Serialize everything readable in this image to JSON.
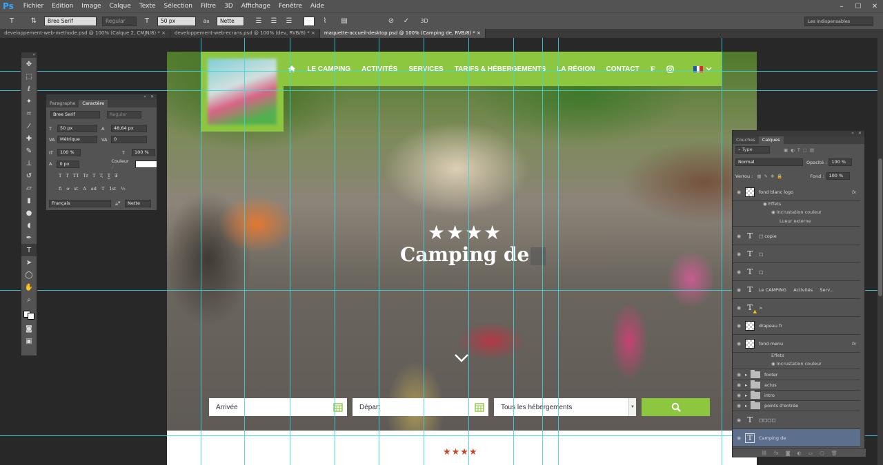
{
  "app": {
    "logo": "Ps",
    "menu": [
      "Fichier",
      "Edition",
      "Image",
      "Calque",
      "Texte",
      "Sélection",
      "Filtre",
      "3D",
      "Affichage",
      "Fenêtre",
      "Aide"
    ],
    "workspace": "Les indispensables"
  },
  "options": {
    "font_family": "Bree Serif",
    "font_style": "Regular",
    "font_size": "50 px",
    "aa": "Nette",
    "aa_label": "a",
    "aa_sup": "a"
  },
  "doc_tabs": [
    {
      "label": "developpement-web-methode.psd @ 100% (Calque 2, CMJN/8) *",
      "close": "×"
    },
    {
      "label": "developpement-web-ecrans.psd @ 100% (dev, RVB/8) *",
      "close": "×"
    },
    {
      "label": "maquette-accueil-desktop.psd @ 100% (Camping de, RVB/8) *",
      "close": "×"
    }
  ],
  "site": {
    "nav": [
      "LE CAMPING",
      "ACTIVITÉS",
      "SERVICES",
      "TARIFS & HÉBERGEMENTS",
      "LA RÉGION",
      "CONTACT"
    ],
    "stars": "★★★★",
    "title": "Camping de",
    "search": {
      "arrival": "Arrivée",
      "departure": "Départ",
      "lodging": "Tous les hébergements"
    },
    "small_stars": "★★★★"
  },
  "char_panel": {
    "tabs": [
      "Paragraphe",
      "Caractère"
    ],
    "font": "Bree Serif",
    "style": "Regular",
    "size": "50 px",
    "leading": "48,64 px",
    "kerning": "Métrique",
    "tracking": "0",
    "vscale": "100 %",
    "hscale": "100 %",
    "baseline": "0 px",
    "color_label": "Couleur :",
    "lang": "Français",
    "aa": "Nette",
    "aa_label": "a",
    "aa_sup": "a",
    "typo_buttons": [
      "T",
      "T",
      "TT",
      "Tr",
      "T",
      "T,",
      "T",
      "T"
    ],
    "opentype": [
      "fi",
      "ơ",
      "st",
      "A",
      "ad",
      "T",
      "1st",
      "½"
    ]
  },
  "layers_panel": {
    "tabs": [
      "Couches",
      "Calques"
    ],
    "filter": "Type",
    "blend": "Normal",
    "opacity_label": "Opacité :",
    "opacity": "100 %",
    "lock_label": "Verrou :",
    "fill_label": "Fond :",
    "fill": "100 %",
    "fx": "fx",
    "layers": [
      {
        "name": "fond blanc logo",
        "kind": "pixel"
      },
      {
        "name": "Effets",
        "kind": "effects"
      },
      {
        "name": "Incrustation couleur",
        "kind": "effect"
      },
      {
        "name": "Lueur externe",
        "kind": "effect"
      },
      {
        "name": "□ copie",
        "kind": "text"
      },
      {
        "name": "□",
        "kind": "text"
      },
      {
        "name": "□",
        "kind": "text"
      },
      {
        "name": "Le CAMPING     Activités     Serv...",
        "kind": "text"
      },
      {
        "name": ">",
        "kind": "text-warn"
      },
      {
        "name": "drapeau fr",
        "kind": "pixel"
      },
      {
        "name": "fond menu",
        "kind": "pixel"
      },
      {
        "name": "Effets",
        "kind": "effects"
      },
      {
        "name": "Incrustation couleur",
        "kind": "effect"
      },
      {
        "name": "footer",
        "kind": "group"
      },
      {
        "name": "actus",
        "kind": "group"
      },
      {
        "name": "intro",
        "kind": "group"
      },
      {
        "name": "points d'entrée",
        "kind": "group"
      },
      {
        "name": "□□□□",
        "kind": "text"
      },
      {
        "name": "Camping de",
        "kind": "text-selected"
      }
    ]
  },
  "colors": {
    "accent_green": "#8dc63f",
    "guide_cyan": "#39d7e2",
    "ps_bg": "#535353",
    "ps_dark": "#282828",
    "stars_red": "#c8462a"
  }
}
